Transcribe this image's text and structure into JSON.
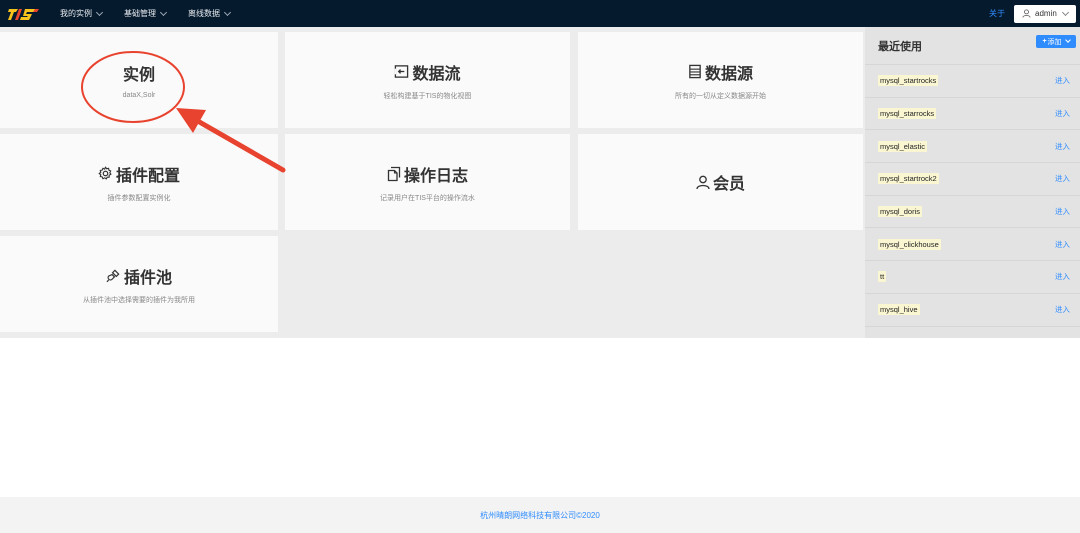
{
  "nav": {
    "items": [
      {
        "label": "我的实例"
      },
      {
        "label": "基础管理"
      },
      {
        "label": "离线数据"
      }
    ],
    "about_label": "关于",
    "user_label": "admin"
  },
  "cards": [
    {
      "title": "实例",
      "desc": "dataX,Solr",
      "icon": "none"
    },
    {
      "title": "数据流",
      "desc": "轻松构建基于TIS的物化视图",
      "icon": "dataflow-icon"
    },
    {
      "title": "数据源",
      "desc": "所有的一切从定义数据源开始",
      "icon": "datasource-icon"
    },
    {
      "title": "插件配置",
      "desc": "插件参数配置实例化",
      "icon": "gear-icon"
    },
    {
      "title": "操作日志",
      "desc": "记录用户在TIS平台的操作流水",
      "icon": "document-icon"
    },
    {
      "title": "会员",
      "desc": "",
      "icon": "user-icon"
    },
    {
      "title": "插件池",
      "desc": "从插件池中选择需要的插件为我所用",
      "icon": "plugin-icon"
    }
  ],
  "recent": {
    "title": "最近使用",
    "add_label": "添加",
    "items": [
      {
        "name": "mysql_startrocks",
        "action": "进入"
      },
      {
        "name": "mysql_starrocks",
        "action": "进入"
      },
      {
        "name": "mysql_elastic",
        "action": "进入"
      },
      {
        "name": "mysql_startrock2",
        "action": "进入"
      },
      {
        "name": "mysql_doris",
        "action": "进入"
      },
      {
        "name": "mysql_clickhouse",
        "action": "进入"
      },
      {
        "name": "tt",
        "action": "进入"
      },
      {
        "name": "mysql_hive",
        "action": "进入"
      }
    ]
  },
  "footer": {
    "text": "杭州晴朗网络科技有限公司©2020"
  },
  "colors": {
    "topbar": "#061a2e",
    "accent": "#2f8cff",
    "annotation": "#e8432e"
  }
}
